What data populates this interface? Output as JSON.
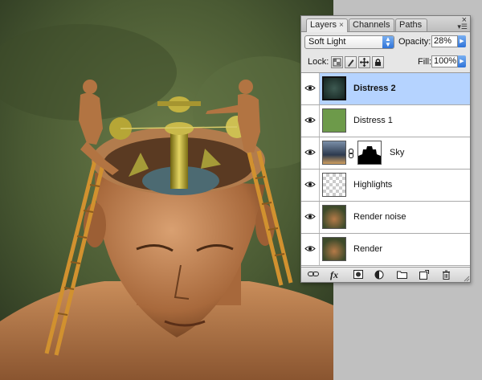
{
  "panel": {
    "tabs": [
      {
        "label": "Layers",
        "active": true,
        "close": "×"
      },
      {
        "label": "Channels",
        "active": false
      },
      {
        "label": "Paths",
        "active": false
      }
    ],
    "close_glyph": "×",
    "menu_glyph": "▾☰"
  },
  "blend": {
    "mode": "Soft Light",
    "opacity_label": "Opacity:",
    "opacity": "28%"
  },
  "lock": {
    "label": "Lock:",
    "fill_label": "Fill:",
    "fill": "100%"
  },
  "layers": [
    {
      "name": "Distress 2",
      "selected": true,
      "bold": true,
      "thumb": "distress-2"
    },
    {
      "name": "Distress 1",
      "selected": false,
      "bold": false,
      "thumb": "distress-1"
    },
    {
      "name": "Sky",
      "selected": false,
      "bold": false,
      "thumb": "sky",
      "has_mask": true
    },
    {
      "name": "Highlights",
      "selected": false,
      "bold": false,
      "thumb": "transparent"
    },
    {
      "name": "Render noise",
      "selected": false,
      "bold": false,
      "thumb": "render"
    },
    {
      "name": "Render",
      "selected": false,
      "bold": false,
      "thumb": "render"
    }
  ],
  "bottom_bar": {
    "icons": [
      "link-icon",
      "fx-icon",
      "mask-icon",
      "adjustment-icon",
      "folder-icon",
      "new-layer-icon",
      "trash-icon"
    ],
    "fx_label": "fx"
  },
  "colors": {
    "selection": "#b5d3ff",
    "accent_blue": "#2e73d8",
    "canvas_green": "#4c5c35"
  }
}
